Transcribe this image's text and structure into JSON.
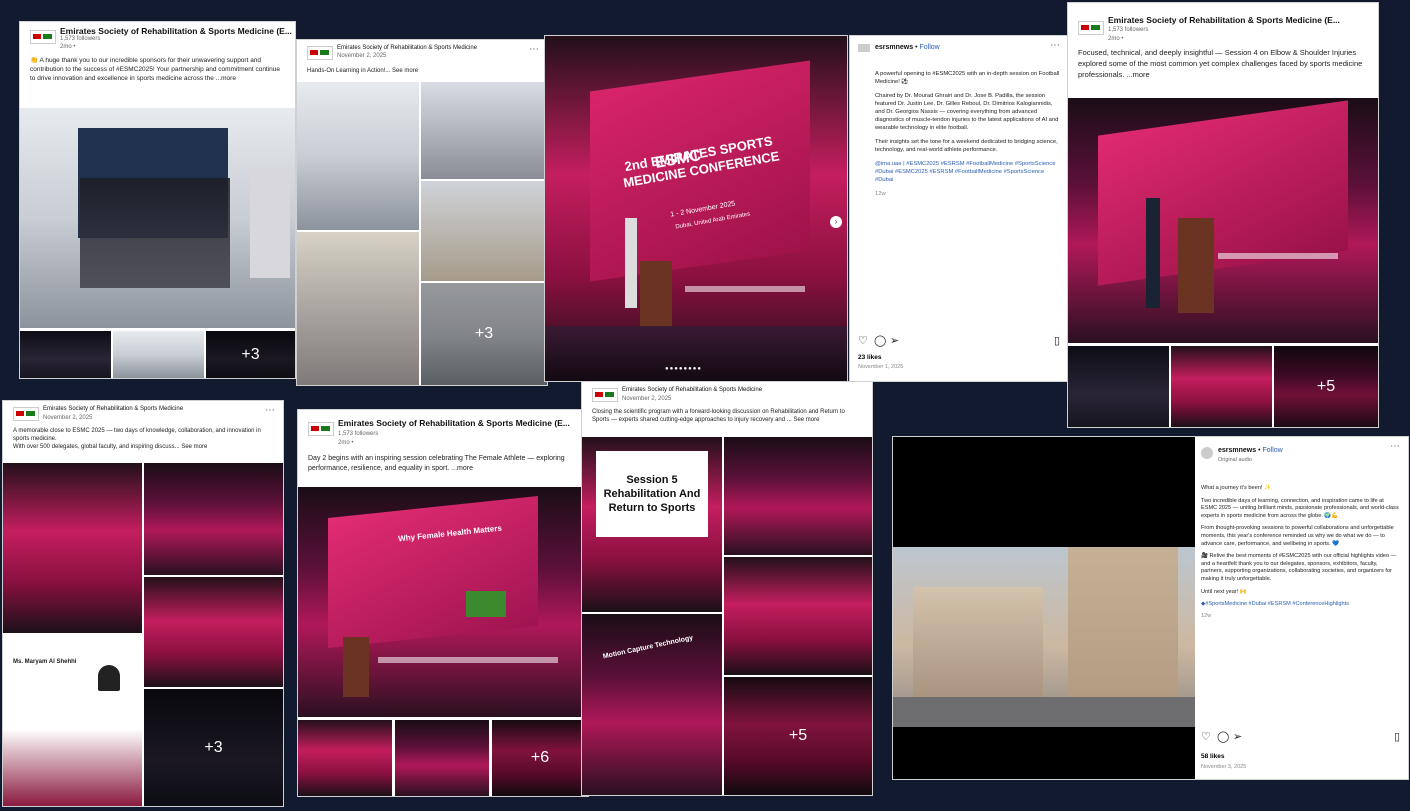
{
  "org_name": "Emirates Society of Rehabilitation & Sports Medicine",
  "org_name_truncated": "Emirates Society of Rehabilitation & Sports Medicine (E...",
  "followers": "1,573 followers",
  "time_2mo": "2mo •",
  "date_nov2": "November 2, 2025",
  "card1": {
    "text": "👏 A huge thank you to our incredible sponsors for their unwavering support and contribution to the success of #ESMC2025! Your partnership and commitment continue to drive innovation and excellence in sports medicine across the ...more",
    "plus": "+3"
  },
  "card2": {
    "text": "Hands-On Learning in Action!... See more",
    "plus": "+3"
  },
  "card3": {
    "title_line1": "2nd EMIRATES SPORTS MEDICINE CONFERENCE",
    "dates": "1 - 2 November 2025",
    "place": "Dubai, United Arab Emirates",
    "acronym": "ESMC"
  },
  "card4": {
    "account": "esrsmnews",
    "follow": "Follow",
    "caption_lead": "A powerful opening to #ESMC2025 with an in-depth session on Football Medicine! ⚽",
    "para1": "Chaired by Dr. Mourad Ghrairi and Dr. Jose B. Padilla, the session featured Dr. Justin Lee, Dr. Gilles Reboul, Dr. Dimitrios Kalogiannidis, and Dr. Georgios Nassis — covering everything from advanced diagnostics of muscle-tendon injuries to the latest applications of AI and wearable technology in elite football.",
    "para2": "Their insights set the tone for a weekend dedicated to bridging science, technology, and real-world athlete performance.",
    "tags": "@ima.uae | #ESMC2025 #ESRSM #FootballMedicine #SportsScience #Dubai #ESMC2025 #ESRSM #FootballMedicine #SportsScience #Dubai",
    "age": "12w",
    "likes": "23 likes",
    "date": "November 1, 2025"
  },
  "card5": {
    "text": "Focused, technical, and deeply insightful — Session 4 on Elbow & Shoulder Injuries explored some of the most common yet complex challenges faced by sports medicine professionals. ...more",
    "plus": "+5"
  },
  "card6": {
    "text1": "A memorable close to ESMC 2025 — two days of knowledge, collaboration, and innovation in sports medicine.",
    "text2": "With over 500 delegates, global faculty, and inspiring discuss... See more",
    "slide_name": "Ms. Maryam Al Shehhi",
    "plus": "+3"
  },
  "card7": {
    "text": "Day 2 begins with an inspiring session celebrating The Female Athlete — exploring performance, resilience, and equality in sport. ...more",
    "slide": "Why Female Health Matters",
    "plus": "+6"
  },
  "card8": {
    "text": "Closing the scientific program with a forward-looking discussion on Rehabilitation and Return to Sports — experts shared cutting-edge approaches to injury recovery and ... See more",
    "slide": "Session 5 Rehabilitation And Return to Sports",
    "slide2": "Motion Capture Technology",
    "plus": "+5"
  },
  "card9": {
    "account": "esrsmnews",
    "follow": "Follow",
    "audio": "Original audio",
    "lead": "What a journey it's been! ✨",
    "para1": "Two incredible days of learning, connection, and inspiration came to life at ESMC 2025 — uniting brilliant minds, passionate professionals, and world-class experts in sports medicine from across the globe. 🌍💪",
    "para2": "From thought-provoking sessions to powerful collaborations and unforgettable moments, this year's conference reminded us why we do what we do — to advance care, performance, and wellbeing in sports. 💙",
    "para3": "🎥 Relive the best moments of #ESMC2025 with our official highlights video — and a heartfelt thank you to our delegates, sponsors, exhibitors, faculty, partners, supporting organizations, collaborating societies, and organizers for making it truly unforgettable.",
    "para4": "Until next year! 🙌",
    "tags": "◆#SportsMedicine #Dubai #ESRSM #ConferenceHighlights",
    "age": "12w",
    "likes": "58 likes",
    "date": "November 3, 2025"
  }
}
